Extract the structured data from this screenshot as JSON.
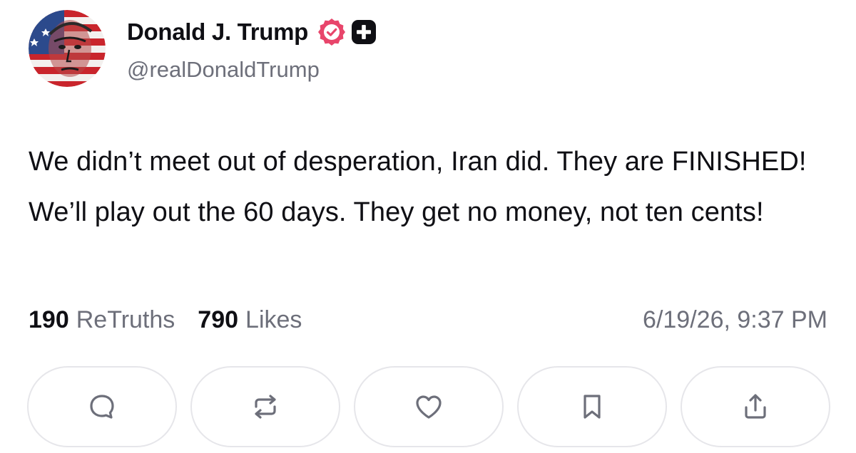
{
  "author": {
    "display_name": "Donald J. Trump",
    "handle": "@realDonaldTrump",
    "avatar_icon": "flag-portrait-avatar",
    "verified_icon": "verified-badge-icon",
    "plus_icon": "plus-badge-icon"
  },
  "post": {
    "text": "We didn’t meet out of desperation, Iran did. They are FINISHED! We’ll play out the 60 days. They get no money, not ten cents!"
  },
  "stats": {
    "retruths_count": "190",
    "retruths_label": "ReTruths",
    "likes_count": "790",
    "likes_label": "Likes",
    "timestamp": "6/19/26, 9:37 PM"
  },
  "actions": [
    {
      "name": "reply",
      "icon": "reply-icon"
    },
    {
      "name": "retruth",
      "icon": "repost-icon"
    },
    {
      "name": "like",
      "icon": "heart-icon"
    },
    {
      "name": "bookmark",
      "icon": "bookmark-icon"
    },
    {
      "name": "share",
      "icon": "share-icon"
    }
  ],
  "colors": {
    "text": "#0f0f14",
    "muted": "#6d6f7a",
    "verified": "#e8456b",
    "border": "#e6e6ea"
  }
}
